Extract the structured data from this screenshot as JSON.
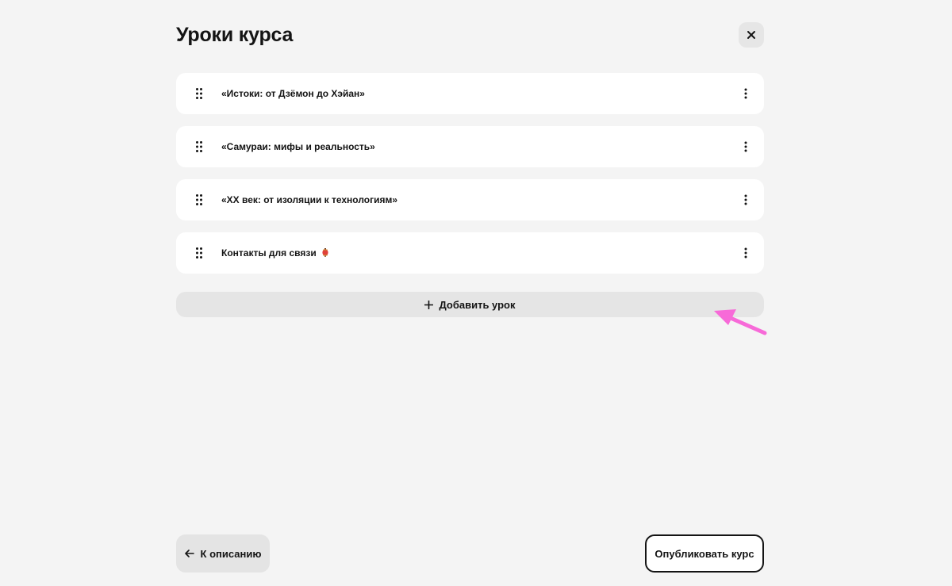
{
  "page": {
    "title": "Уроки курса"
  },
  "lessons": [
    {
      "title": "«Истоки: от Дзёмон до Хэйан»",
      "emoji": false
    },
    {
      "title": "«Самураи: мифы и реальность»",
      "emoji": false
    },
    {
      "title": "«XX век: от изоляции к технологиям»",
      "emoji": false
    },
    {
      "title": "Контакты для связи",
      "emoji": true
    }
  ],
  "actions": {
    "add_lesson": "Добавить урок",
    "back": "К описанию",
    "publish": "Опубликовать курс"
  },
  "icons": {
    "close": "close-icon",
    "drag": "drag-handle-icon",
    "menu": "more-vertical-icon",
    "plus": "plus-icon",
    "back": "arrow-left-icon",
    "lesson_emoji": "red-lantern-icon"
  },
  "colors": {
    "background": "#f4f4f4",
    "card": "#ffffff",
    "button_gray": "#e5e5e5",
    "text": "#141414",
    "annotation_arrow": "#f76ad8"
  }
}
